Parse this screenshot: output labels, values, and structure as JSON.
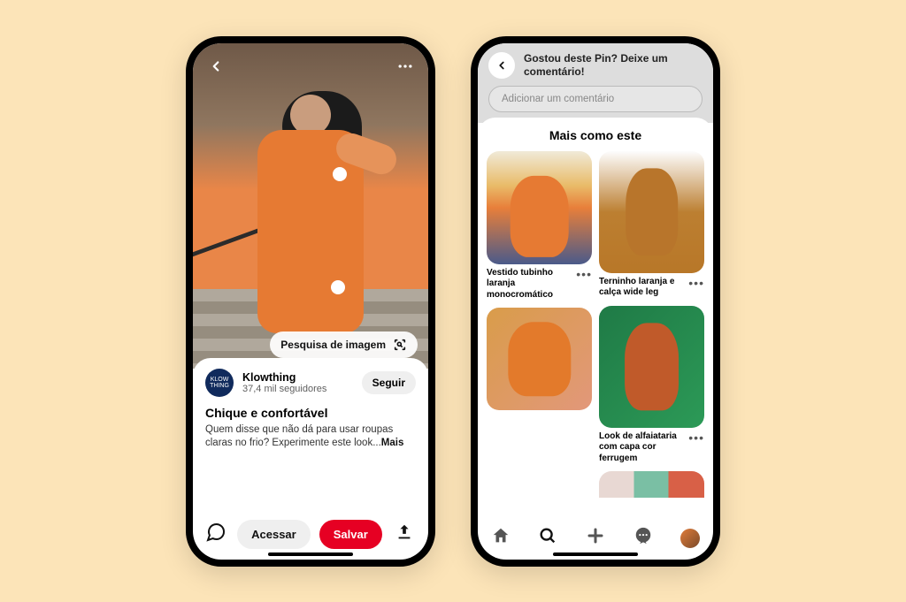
{
  "phone1": {
    "image_search_label": "Pesquisa de imagem",
    "author": {
      "name": "Klowthing",
      "followers": "37,4 mil seguidores",
      "logo_text": "KLOW\nTHING"
    },
    "follow_label": "Seguir",
    "title": "Chique e confortável",
    "description": "Quem disse que não dá para usar roupas claras no frio? Experimente este look...",
    "more_label": "Mais",
    "bottom": {
      "access_label": "Acessar",
      "save_label": "Salvar"
    }
  },
  "phone2": {
    "prompt": "Gostou deste Pin? Deixe um comentário!",
    "comment_placeholder": "Adicionar um comentário",
    "more_like_title": "Mais como este",
    "pins": [
      {
        "caption": "Vestido tubinho laranja monocromático"
      },
      {
        "caption": "Terninho laranja e calça wide leg"
      },
      {
        "caption": ""
      },
      {
        "caption": "Look de alfaiataria com capa cor ferrugem"
      }
    ]
  }
}
